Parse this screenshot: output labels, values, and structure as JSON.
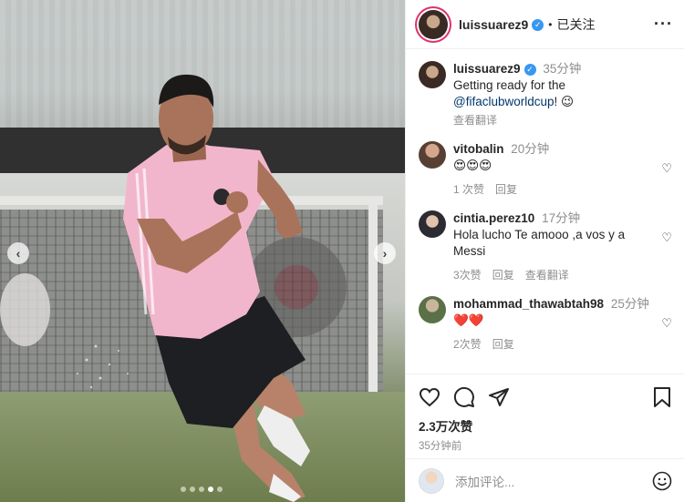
{
  "post": {
    "author": "luissuarez9",
    "follow_label": "已关注",
    "separator": "•",
    "more_label": "···",
    "caption": {
      "username": "luissuarez9",
      "time": "35分钟",
      "text_before": "Getting ready for the",
      "mention": "@fifaclubworldcup",
      "text_after": "! 😉",
      "translate_label": "查看翻译"
    },
    "comments": [
      {
        "username": "vitobalin",
        "time": "20分钟",
        "text": "😍😍😍",
        "likes": "1 次赞",
        "reply": "回复",
        "translate": ""
      },
      {
        "username": "cintia.perez10",
        "time": "17分钟",
        "text": "Hola lucho Te amooo ,a vos y a Messi",
        "likes": "3次赞",
        "reply": "回复",
        "translate": "查看翻译"
      },
      {
        "username": "mohammad_thawabtah98",
        "time": "25分钟",
        "text": "❤️❤️",
        "likes": "2次赞",
        "reply": "回复",
        "translate": ""
      }
    ],
    "like_count": "2.3万次赞",
    "posted_time": "35分钟前",
    "comment_placeholder": "添加评论...",
    "emoji_label": "☺"
  },
  "carousel": {
    "prev": "‹",
    "next": "›",
    "total": 5,
    "active_index": 3
  },
  "colors": {
    "verified": "#3897f0",
    "mention": "#00376b",
    "shirt": "#f2b6cc",
    "meta": "#8e8e8e"
  }
}
